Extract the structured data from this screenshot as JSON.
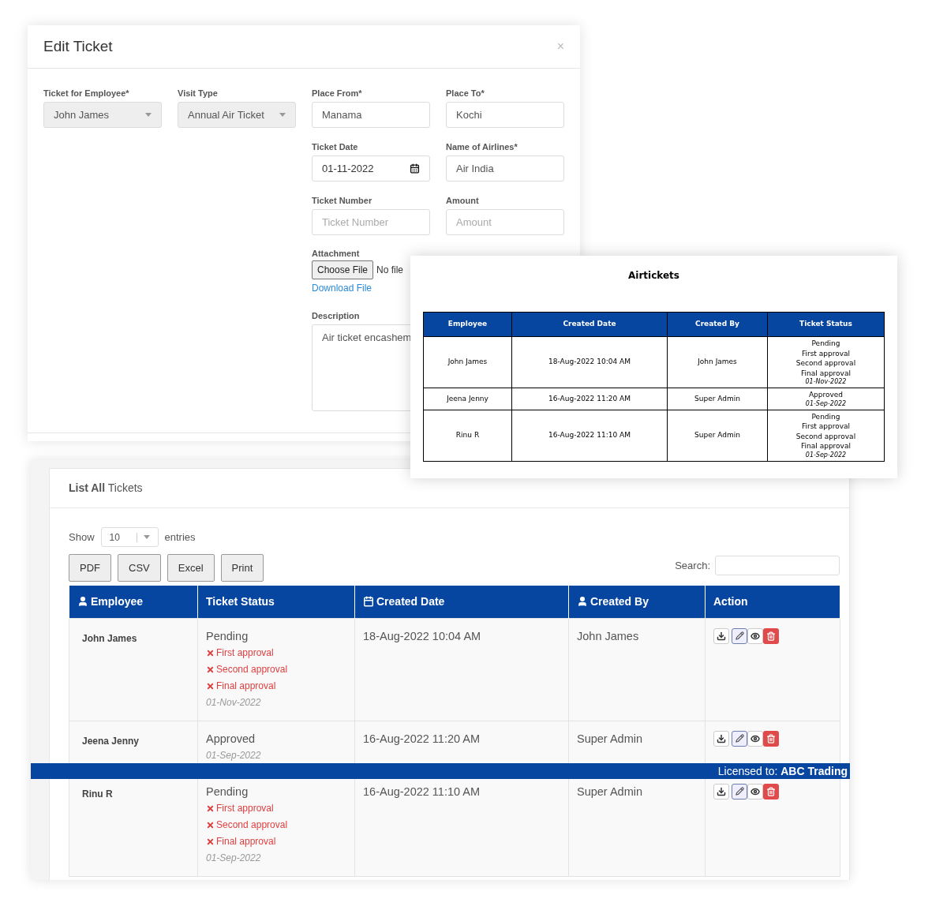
{
  "edit_ticket": {
    "title": "Edit Ticket",
    "close": "×",
    "fields": [
      {
        "label": "Ticket for Employee*",
        "kind": "select",
        "value": "John James"
      },
      {
        "label": "Visit Type",
        "kind": "select",
        "value": "Annual Air Ticket"
      },
      {
        "label": "Place From*",
        "kind": "text",
        "value": "Manama"
      },
      {
        "label": "Place To*",
        "kind": "text",
        "value": "Kochi"
      },
      {
        "label": "Ticket Date",
        "kind": "date",
        "value": "01-11-2022"
      },
      {
        "label": "Name of Airlines*",
        "kind": "text",
        "value": "Air India"
      },
      {
        "label": "Ticket Number",
        "kind": "text",
        "placeholder": "Ticket Number"
      },
      {
        "label": "Amount",
        "kind": "text",
        "placeholder": "Amount"
      }
    ],
    "attachment": {
      "label": "Attachment",
      "button": "Choose File",
      "status": "No file",
      "link": "Download File"
    },
    "description": {
      "label": "Description",
      "value": "Air ticket encashem"
    }
  },
  "pdf_preview": {
    "title": "Airtickets",
    "columns": [
      "Employee",
      "Created Date",
      "Created By",
      "Ticket Status"
    ],
    "rows": [
      {
        "employee": "John James",
        "created_date": "18-Aug-2022 10:04 AM",
        "created_by": "John James",
        "status_lines": [
          "Pending",
          "First approval",
          "Second approval",
          "Final approval"
        ],
        "date": "01-Nov-2022"
      },
      {
        "employee": "Jeena Jenny",
        "created_date": "16-Aug-2022 11:20 AM",
        "created_by": "Super Admin",
        "status_lines": [
          "Approved"
        ],
        "date": "01-Sep-2022"
      },
      {
        "employee": "Rinu R",
        "created_date": "16-Aug-2022 11:10 AM",
        "created_by": "Super Admin",
        "status_lines": [
          "Pending",
          "First approval",
          "Second approval",
          "Final approval"
        ],
        "date": "01-Sep-2022"
      }
    ]
  },
  "ticket_list": {
    "title_bold": "List All",
    "title_rest": "Tickets",
    "show_label": "Show",
    "page_size": "10",
    "entries_label": "entries",
    "export_buttons": [
      "PDF",
      "CSV",
      "Excel",
      "Print"
    ],
    "search_label": "Search:",
    "columns": [
      {
        "label": "Employee",
        "kind": "person"
      },
      {
        "label": "Ticket Status",
        "kind": "plain"
      },
      {
        "label": "Created Date",
        "kind": "date"
      },
      {
        "label": "Created By",
        "kind": "person"
      },
      {
        "label": "Action",
        "kind": "plain"
      }
    ],
    "rows": [
      {
        "employee": "John James",
        "status": "Pending",
        "approvals": [
          "First approval",
          "Second approval",
          "Final approval"
        ],
        "date": "01-Nov-2022",
        "created_date": "18-Aug-2022 10:04 AM",
        "created_by": "John James"
      },
      {
        "employee": "Jeena Jenny",
        "status": "Approved",
        "approvals": [],
        "date": "01-Sep-2022",
        "created_date": "16-Aug-2022 11:20 AM",
        "created_by": "Super Admin"
      },
      {
        "employee": "Rinu R",
        "status": "Pending",
        "approvals": [
          "First approval",
          "Second approval",
          "Final approval"
        ],
        "date": "01-Sep-2022",
        "created_date": "16-Aug-2022 11:10 AM",
        "created_by": "Super Admin"
      }
    ],
    "license": {
      "label": "Licensed to:",
      "value": "ABC Trading"
    }
  }
}
